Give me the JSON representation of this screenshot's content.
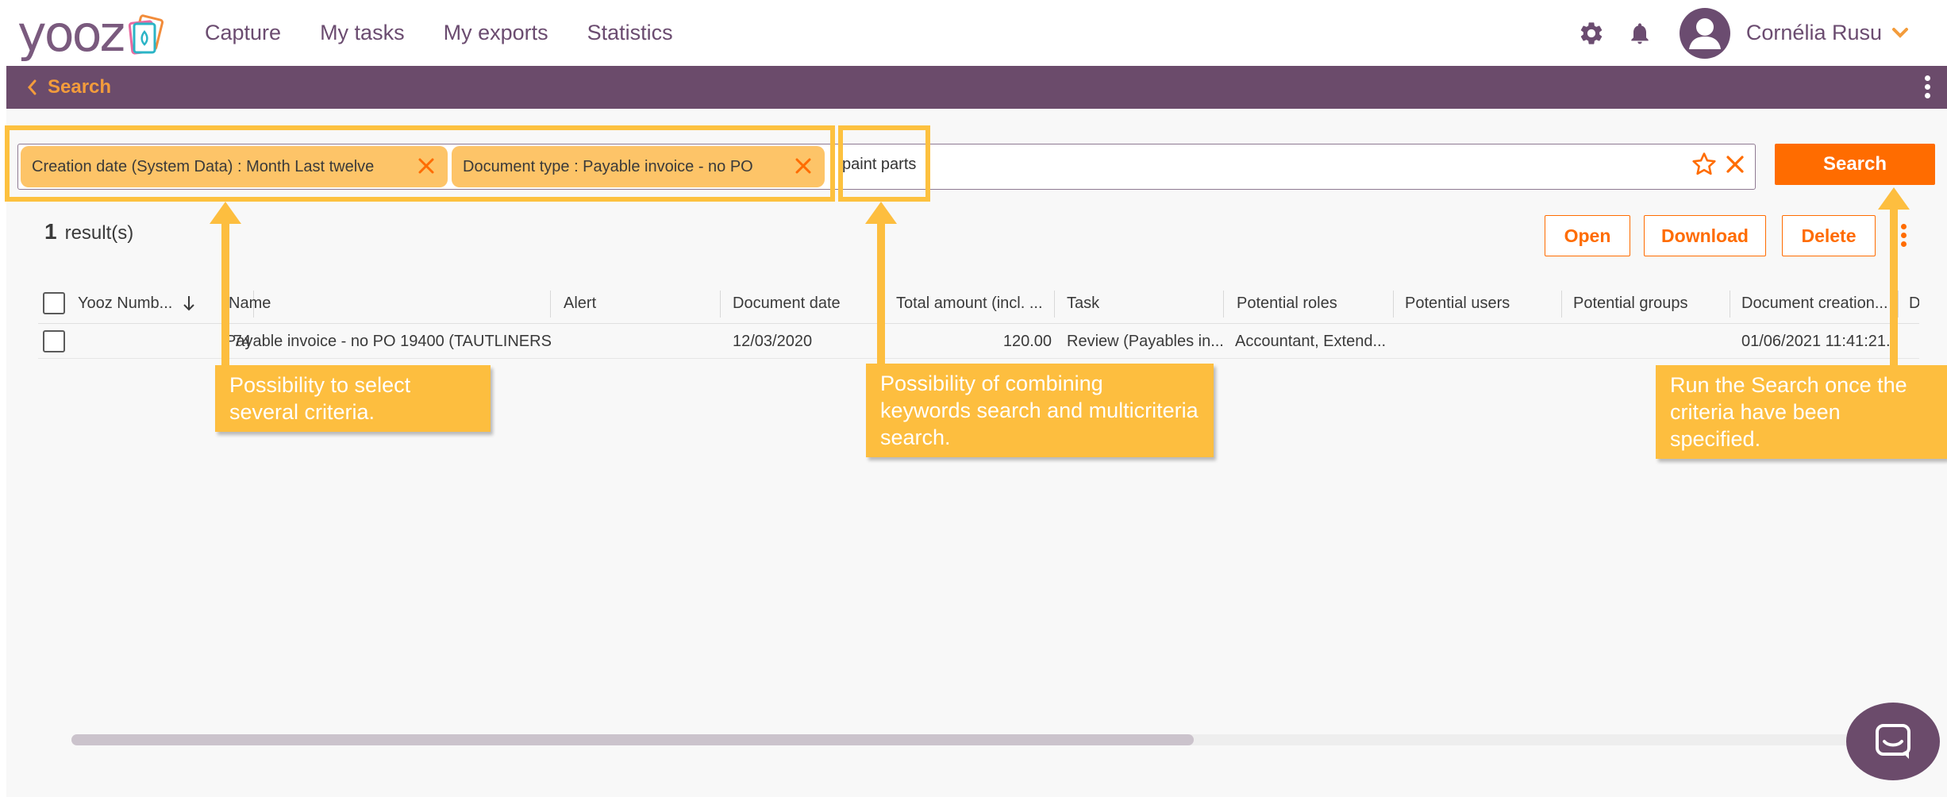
{
  "header": {
    "logo_text": "yooz",
    "nav": [
      "Capture",
      "My tasks",
      "My exports",
      "Statistics"
    ],
    "user_name": "Cornélia Rusu"
  },
  "subbar": {
    "back_label": "Search"
  },
  "search": {
    "chips": [
      {
        "label": "Creation date (System Data) : Month Last twelve"
      },
      {
        "label": "Document type : Payable invoice - no PO"
      }
    ],
    "keyword": "paint parts",
    "button_label": "Search"
  },
  "results": {
    "count": "1",
    "suffix": "result(s)"
  },
  "actions": {
    "open": "Open",
    "download": "Download",
    "delete": "Delete"
  },
  "table": {
    "columns": [
      "Yooz Numb...",
      "Name",
      "Alert",
      "Document date",
      "Total amount (incl. ...",
      "Task",
      "Potential roles",
      "Potential users",
      "Potential groups",
      "Document creation...",
      "D"
    ],
    "rows": [
      {
        "number": "74",
        "name": "Payable invoice - no PO 19400 (TAUTLINERS ...",
        "alert": "",
        "document_date": "12/03/2020",
        "total_amount": "120.00",
        "task": "Review (Payables in...",
        "potential_roles": "Accountant, Extend...",
        "potential_users": "",
        "potential_groups": "",
        "document_creation": "01/06/2021 11:41:21..."
      }
    ]
  },
  "annotations": {
    "criteria": "Possibility to select several criteria.",
    "keywords": "Possibility of combining keywords search and multicriteria search.",
    "run": "Run the Search once the criteria have been specified."
  },
  "colors": {
    "brand_purple": "#6b4b6b",
    "accent_orange": "#ff6c00",
    "chip_yellow": "#fdc468",
    "annotation_yellow": "#fdbe3f"
  }
}
